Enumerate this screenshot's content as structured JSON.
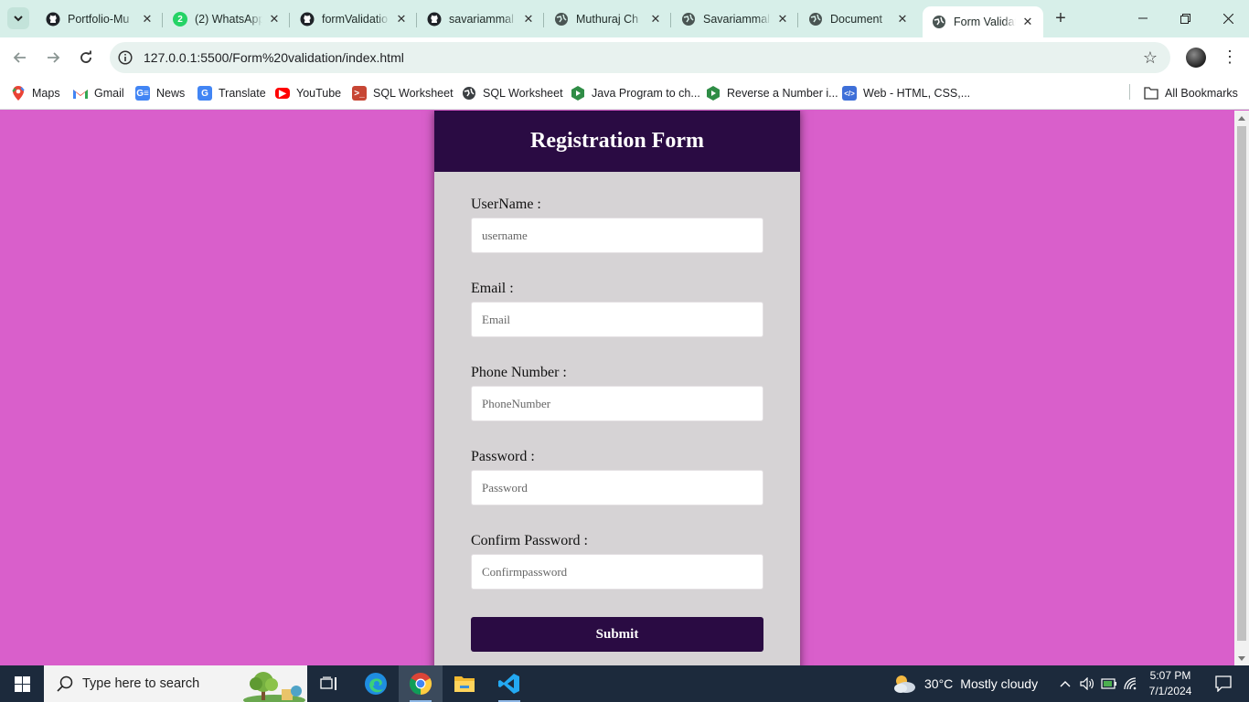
{
  "browser": {
    "tabs": [
      {
        "title": "Portfolio-Mu",
        "icon": "github-icon"
      },
      {
        "title": "(2) WhatsApp",
        "icon": "whatsapp-icon",
        "badge": "2"
      },
      {
        "title": "formValidatio",
        "icon": "github-icon"
      },
      {
        "title": "savariammal",
        "icon": "github-icon"
      },
      {
        "title": "Muthuraj Ch",
        "icon": "globe-icon"
      },
      {
        "title": "Savariammal",
        "icon": "globe-icon"
      },
      {
        "title": "Document",
        "icon": "globe-icon"
      },
      {
        "title": "Form Validat",
        "icon": "globe-icon",
        "active": true
      }
    ],
    "url": "127.0.0.1:5500/Form%20validation/index.html",
    "bookmarks": [
      {
        "label": "Maps",
        "icon": "maps-icon"
      },
      {
        "label": "Gmail",
        "icon": "gmail-icon"
      },
      {
        "label": "News",
        "icon": "news-icon"
      },
      {
        "label": "Translate",
        "icon": "translate-icon"
      },
      {
        "label": "YouTube",
        "icon": "youtube-icon"
      },
      {
        "label": "SQL Worksheet",
        "icon": "terminal-icon"
      },
      {
        "label": "SQL Worksheet",
        "icon": "globe-icon"
      },
      {
        "label": "Java Program to ch...",
        "icon": "green-play-icon"
      },
      {
        "label": "Reverse a Number i...",
        "icon": "green-play-icon"
      },
      {
        "label": "Web - HTML, CSS,...",
        "icon": "code-icon"
      }
    ],
    "all_bookmarks": "All Bookmarks"
  },
  "form": {
    "title": "Registration Form",
    "fields": [
      {
        "label": "UserName :",
        "placeholder": "username"
      },
      {
        "label": "Email :",
        "placeholder": "Email"
      },
      {
        "label": "Phone Number :",
        "placeholder": "PhoneNumber"
      },
      {
        "label": "Password :",
        "placeholder": "Password"
      },
      {
        "label": "Confirm Password :",
        "placeholder": "Confirmpassword"
      }
    ],
    "submit_label": "Submit"
  },
  "taskbar": {
    "search_placeholder": "Type here to search",
    "weather": {
      "temp": "30°C",
      "condition": "Mostly cloudy"
    },
    "time": "5:07 PM",
    "date": "7/1/2024"
  },
  "colors": {
    "page_background": "#d95fcb",
    "form_header": "#2a0b43",
    "form_body": "#d6d3d5",
    "submit_button": "#2a0b43"
  }
}
